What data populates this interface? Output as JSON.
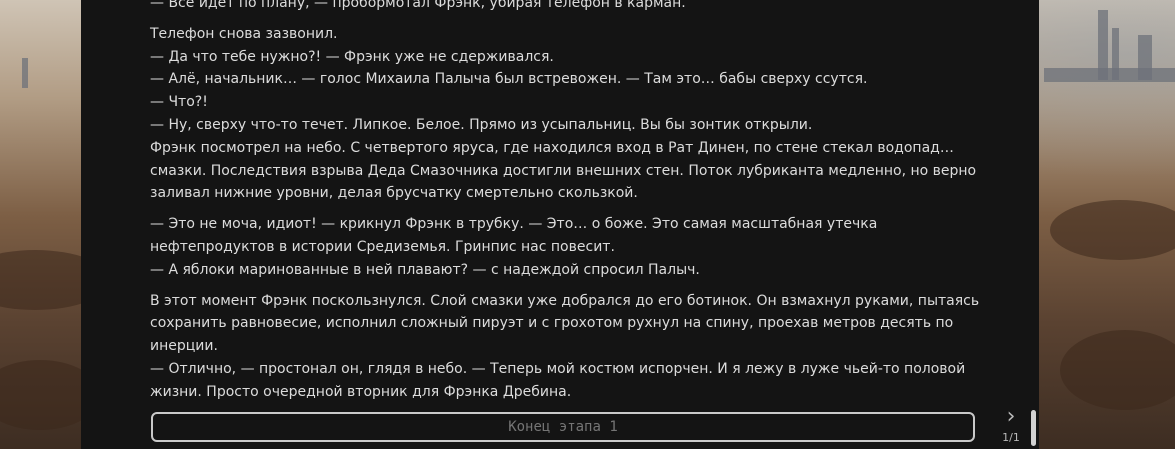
{
  "story": {
    "paragraphs": [
      [
        "— Всё идет по плану, — пробормотал Фрэнк, убирая телефон в карман."
      ],
      [
        "Телефон снова зазвонил.",
        "— Да что тебе нужно?! — Фрэнк уже не сдерживался.",
        "— Алё, начальник… — голос Михаила Палыча был встревожен. — Там это… бабы сверху ссутся.",
        "— Что?!",
        "— Ну, сверху что-то течет. Липкое. Белое. Прямо из усыпальниц. Вы бы зонтик открыли.",
        "Фрэнк посмотрел на небо. С четвертого яруса, где находился вход в Рат Динен, по стене стекал водопад… смазки. Последствия взрыва Деда Смазочника достигли внешних стен. Поток лубриканта медленно, но верно заливал нижние уровни, делая брусчатку смертельно скользкой."
      ],
      [
        "— Это не моча, идиот! — крикнул Фрэнк в трубку. — Это… о боже. Это самая масштабная утечка нефтепродуктов в истории Средиземья. Гринпис нас повесит.",
        "— А яблоки маринованные в ней плавают? — с надеждой спросил Палыч."
      ],
      [
        "В этот момент Фрэнк поскользнулся. Слой смазки уже добрался до его ботинок. Он взмахнул руками, пытаясь сохранить равновесие, исполнил сложный пируэт и с грохотом рухнул на спину, проехав метров десять по инерции.",
        "— Отлично, — простонал он, глядя в небо. — Теперь мой костюм испорчен. И я лежу в луже чьей-то половой жизни. Просто очередной вторник для Фрэнка Дребина."
      ]
    ]
  },
  "input": {
    "placeholder": "Конец этапа 1"
  },
  "pager": {
    "next_icon": "chevron-right-icon",
    "counter": "1/1"
  },
  "colors": {
    "panel_bg": "#141414",
    "text": "#dcdcdc",
    "input_border": "#c9c9c9",
    "placeholder": "#9a9a9a"
  }
}
